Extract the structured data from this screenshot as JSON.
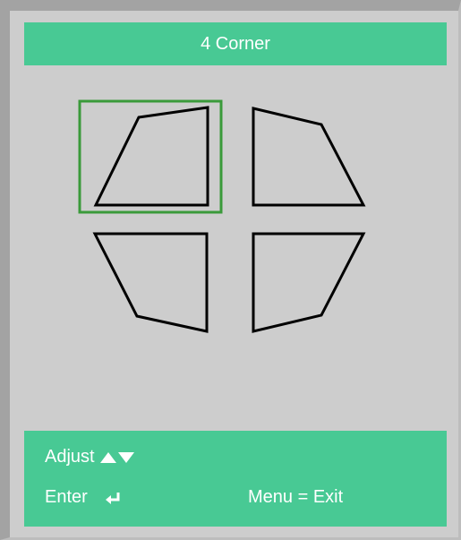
{
  "title": "4 Corner",
  "corners": {
    "items": [
      {
        "id": "top-left",
        "selected": true
      },
      {
        "id": "top-right",
        "selected": false
      },
      {
        "id": "bottom-left",
        "selected": false
      },
      {
        "id": "bottom-right",
        "selected": false
      }
    ],
    "highlight_color": "#3a9a3a"
  },
  "footer": {
    "adjust_label": "Adjust",
    "adjust_icon": "up-down-arrows-icon",
    "enter_label": "Enter",
    "enter_icon": "enter-return-icon",
    "menu_exit_label": "Menu = Exit"
  },
  "colors": {
    "panel_bg": "#cdcdcd",
    "bar_green": "#48c994",
    "text": "#ffffff",
    "outline": "#000000"
  }
}
